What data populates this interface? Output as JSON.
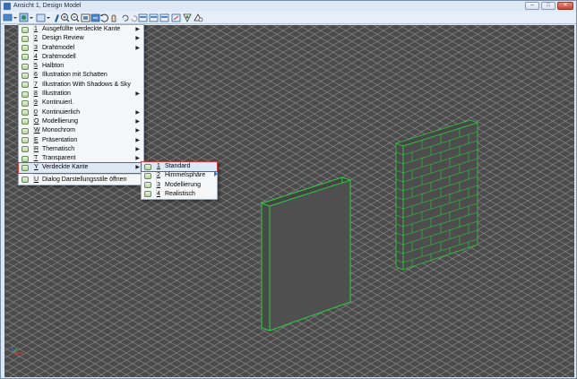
{
  "window": {
    "title": "Ansicht 1, Design Model",
    "controls": [
      "minimize",
      "maximize",
      "close"
    ],
    "close_color": "#c34531"
  },
  "toolbar": {
    "icons": [
      "view-attributes-icon",
      "display-style-icon",
      "update-view-icon",
      "zoom-in-icon",
      "zoom-out-icon",
      "window-area-icon",
      "fit-view-icon",
      "rotate-view-icon",
      "pan-view-icon",
      "view-previous-icon",
      "view-next-icon",
      "copy-view-icon",
      "view-toggle-icon",
      "clip-volume-icon",
      "clip-mask-icon",
      "camera-icon",
      "section-icon"
    ]
  },
  "menu": {
    "items": [
      {
        "key": "1",
        "label": "Ausgefüllte verdeckte Kante",
        "submenu": true
      },
      {
        "key": "2",
        "label": "Design Review",
        "submenu": true
      },
      {
        "key": "3",
        "label": "Drahtmodel",
        "submenu": true
      },
      {
        "key": "4",
        "label": "Drahtmodell",
        "submenu": false
      },
      {
        "key": "5",
        "label": "Halbton",
        "submenu": false
      },
      {
        "key": "6",
        "label": "Illustration mit  Schatten",
        "submenu": false
      },
      {
        "key": "7",
        "label": "Illustration With Shadows & Sky",
        "submenu": false
      },
      {
        "key": "8",
        "label": "Illustration",
        "submenu": true
      },
      {
        "key": "9",
        "label": "Kontinuierl.",
        "submenu": false
      },
      {
        "key": "0",
        "label": "Kontinuierlich",
        "submenu": true
      },
      {
        "key": "O",
        "label": "Modellierung",
        "submenu": true
      },
      {
        "key": "W",
        "label": "Monochrom",
        "submenu": true
      },
      {
        "key": "E",
        "label": "Präsentation",
        "submenu": true
      },
      {
        "key": "R",
        "label": "Thematisch",
        "submenu": true
      },
      {
        "key": "T",
        "label": "Transparent",
        "submenu": true
      },
      {
        "key": "Y",
        "label": "Verdeckte Kante",
        "submenu": true,
        "highlighted": true
      }
    ],
    "footer": {
      "key": "U",
      "label": "Dialog Darstellungsstile öffnen"
    }
  },
  "submenu": {
    "items": [
      {
        "key": "1",
        "label": "Standard",
        "highlighted": true
      },
      {
        "key": "2",
        "label": "Himmelsphäre"
      },
      {
        "key": "3",
        "label": "Modellierung"
      },
      {
        "key": "4",
        "label": "Realistisch"
      }
    ]
  },
  "viewport": {
    "background": "#4b4b4b",
    "grid_color": "#969696",
    "edge_color": "#2ecc40",
    "objects": [
      "plain-wall-panel",
      "brick-wall-panel"
    ]
  }
}
